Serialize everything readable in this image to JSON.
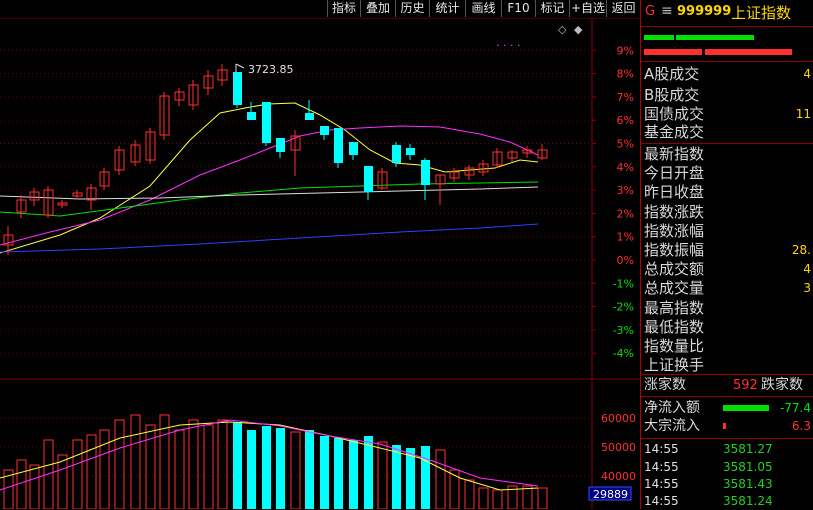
{
  "toolbar": {
    "items": [
      "指标",
      "叠加",
      "历史",
      "统计",
      "画线",
      "F10",
      "标记",
      "+自选",
      "返回"
    ]
  },
  "price_chart": {
    "high_label": "3723.85",
    "dots_label": ". . . .",
    "y_ticks": [
      "9%",
      "8%",
      "7%",
      "6%",
      "5%",
      "4%",
      "3%",
      "2%",
      "1%",
      "0%",
      "-1%",
      "-2%",
      "-3%",
      "-4%"
    ]
  },
  "volume_chart": {
    "y_ticks": [
      "60000",
      "50000",
      "40000"
    ],
    "current_label": "29889"
  },
  "panel": {
    "g_label": "G",
    "menu_icon": "≡",
    "code": "999999",
    "name": "上证指数",
    "rows": [
      {
        "label": "A股成交",
        "value": "4"
      },
      {
        "label": "B股成交",
        "value": ""
      },
      {
        "label": "国债成交",
        "value": "11"
      },
      {
        "label": "基金成交",
        "value": ""
      }
    ],
    "stats": [
      {
        "label": "最新指数",
        "value": ""
      },
      {
        "label": "今日开盘",
        "value": ""
      },
      {
        "label": "昨日收盘",
        "value": ""
      },
      {
        "label": "指数涨跌",
        "value": ""
      },
      {
        "label": "指数涨幅",
        "value": ""
      },
      {
        "label": "指数振幅",
        "value": "28."
      },
      {
        "label": "总成交额",
        "value": "4"
      },
      {
        "label": "总成交量",
        "value": "3"
      },
      {
        "label": "最高指数",
        "value": ""
      },
      {
        "label": "最低指数",
        "value": ""
      },
      {
        "label": "指数量比",
        "value": ""
      },
      {
        "label": "上证换手",
        "value": ""
      }
    ],
    "rise_label": "涨家数",
    "rise_value": "592",
    "fall_label": "跌家数",
    "netflow_label": "净流入额",
    "netflow_value": "-77.4",
    "block_label": "大宗流入",
    "block_value": "6.3",
    "ticks": [
      {
        "time": "14:55",
        "price": "3581.27"
      },
      {
        "time": "14:55",
        "price": "3581.05"
      },
      {
        "time": "14:55",
        "price": "3581.43"
      },
      {
        "time": "14:55",
        "price": "3581.24"
      }
    ],
    "colors": {
      "up": "#ff3030",
      "down": "#00ffff",
      "green": "#00e000",
      "yellow": "#ffd700"
    }
  }
}
